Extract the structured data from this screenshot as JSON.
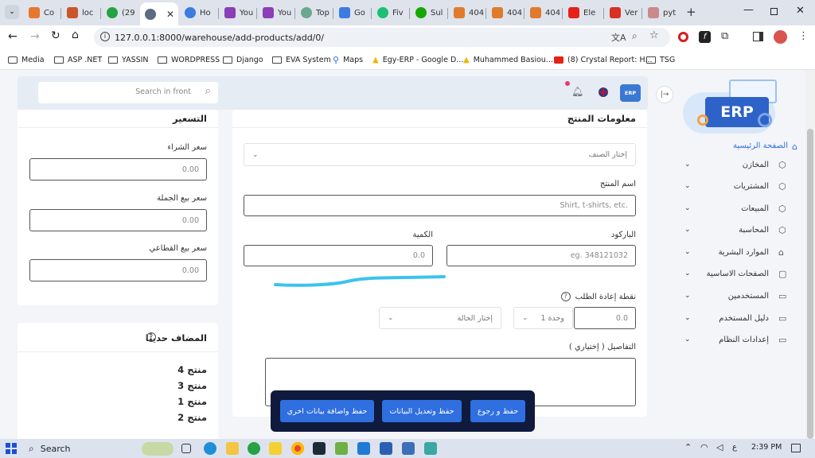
{
  "browser": {
    "tabs": [
      "Co",
      "loc",
      "(29",
      "",
      "Ho",
      "You",
      "You",
      "Top",
      "Go",
      "Fiv",
      "Sul",
      "404",
      "404",
      "404",
      "Ele",
      "Ver",
      "pyt"
    ],
    "url": "127.0.0.1:8000/warehouse/add-products/add/0/",
    "bookmarks": [
      "Media",
      "ASP .NET",
      "YASSIN",
      "WORDPRESS",
      "Django",
      "EVA System",
      "Maps",
      "Egy-ERP - Google D...",
      "Muhammed Basiou...",
      "(8) Crystal Report: H...",
      "TSG"
    ]
  },
  "header": {
    "search_placeholder": "Search in front",
    "logo_text": "ERP",
    "avatar_text": "ERP"
  },
  "sidebar": {
    "items": [
      {
        "label": "الصفحة الرئيسية"
      },
      {
        "label": "المخازن"
      },
      {
        "label": "المشتريات"
      },
      {
        "label": "المبيعات"
      },
      {
        "label": "المحاسبة"
      },
      {
        "label": "الموارد البشرية"
      },
      {
        "label": "الصفحات الاساسية"
      },
      {
        "label": "المستخدمين"
      },
      {
        "label": "دليل المستخدم"
      },
      {
        "label": "إعدادات النظام"
      }
    ]
  },
  "product_info": {
    "title": "معلومات المنتج",
    "category_select": "إختار الصنف",
    "name_label": "اسم المنتج",
    "name_placeholder": "Shirt, t-shirts, etc.",
    "barcode_label": "الباركود",
    "barcode_placeholder": "eg. 348121032",
    "quantity_label": "الكمية",
    "quantity_placeholder": "0.0",
    "reorder_label": "نقطة إعادة الطلب",
    "reorder_value": "0.0",
    "unit_select": "وحدة 1",
    "status_select": "إختار الحالة",
    "details_label": "التفاصيل ( إختياري )"
  },
  "pricing": {
    "title": "التسعير",
    "purchase_label": "سعر الشراء",
    "purchase_value": "0.00",
    "wholesale_label": "سعر بيع الجملة",
    "wholesale_value": "0.00",
    "retail_label": "سعر بيع القطاعي",
    "retail_value": "0.00"
  },
  "recent": {
    "title": "المضاف حديثًا",
    "items": [
      "منتج 4",
      "منتج 3",
      "منتج 1",
      "منتج 2"
    ]
  },
  "actions": {
    "save_back": "حفظ و رجوع",
    "save_edit": "حفظ وتعديل البيانات",
    "save_add": "حفظ واضافة بيانات اخري"
  },
  "taskbar": {
    "search": "Search",
    "lang": "ع",
    "time": "2:39 PM"
  },
  "colors": {
    "accent": "#2f6fe0",
    "annotation": "#3cc3ee",
    "action_bar": "#0f1a3d"
  }
}
